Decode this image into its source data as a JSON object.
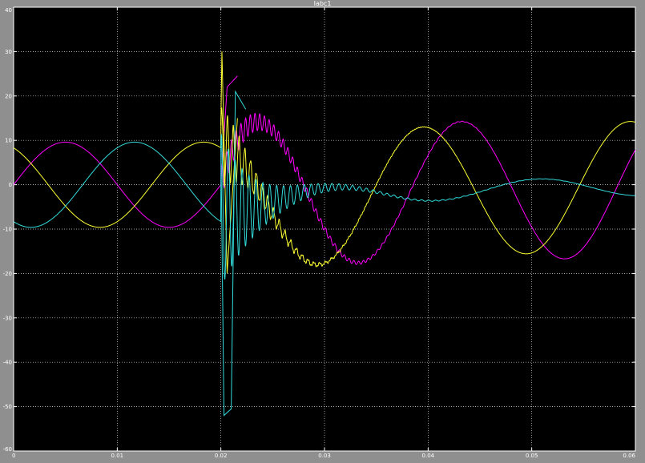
{
  "window": {
    "title": "Iabc1"
  },
  "chart_data": {
    "type": "line",
    "title": "Iabc1",
    "xlabel": "",
    "ylabel": "",
    "xlim": [
      0,
      0.06
    ],
    "ylim": [
      -60,
      40
    ],
    "x_ticks": [
      0,
      0.01,
      0.02,
      0.03,
      0.04,
      0.05,
      0.06
    ],
    "x_tick_labels": [
      "0",
      "0.01",
      "0.02",
      "0.03",
      "0.04",
      "0.05",
      "0.06"
    ],
    "y_ticks": [
      -60,
      -50,
      -40,
      -30,
      -20,
      -10,
      0,
      10,
      20,
      30,
      40
    ],
    "y_tick_labels": [
      "-60",
      "-50",
      "-40",
      "-30",
      "-20",
      "-10",
      "0",
      "10",
      "20",
      "30",
      "40"
    ],
    "grid": true,
    "fault_time": 0.02,
    "series": [
      {
        "color": "#ff00ff",
        "pre_fault": {
          "amplitude": 9.6,
          "phase_deg": 0
        },
        "post_fault": {
          "amplitude": 15.8,
          "dc_offset_peak": 8,
          "peak_time": 0.0432
        },
        "points": [
          [
            0.0,
            0.2
          ],
          [
            0.005,
            9.6
          ],
          [
            0.01,
            0.2
          ],
          [
            0.015,
            -9.6
          ],
          [
            0.0199,
            -0.3
          ],
          [
            0.0206,
            22
          ],
          [
            0.0216,
            24.5
          ],
          [
            0.0226,
            26.5
          ],
          [
            0.024,
            18
          ],
          [
            0.026,
            12
          ],
          [
            0.028,
            2
          ],
          [
            0.03,
            -8
          ],
          [
            0.0332,
            -15.5
          ],
          [
            0.0382,
            0
          ],
          [
            0.0432,
            15.8
          ],
          [
            0.0482,
            0
          ],
          [
            0.0532,
            -15.7
          ],
          [
            0.0582,
            0
          ],
          [
            0.06,
            6
          ]
        ]
      },
      {
        "color": "#ffff33",
        "pre_fault": {
          "amplitude": 9.6,
          "phase_deg": 120
        },
        "post_fault": {
          "amplitude": 14.7,
          "dc_offset_peak": 0,
          "peak_time": 0.0395
        },
        "points": [
          [
            0.0,
            8.3
          ],
          [
            0.0083,
            -9.6
          ],
          [
            0.0183,
            9.6
          ],
          [
            0.0199,
            8.5
          ],
          [
            0.0201,
            30
          ],
          [
            0.0206,
            -20
          ],
          [
            0.0216,
            15
          ],
          [
            0.023,
            10
          ],
          [
            0.025,
            2
          ],
          [
            0.0265,
            -10
          ],
          [
            0.0295,
            -15
          ],
          [
            0.0345,
            0
          ],
          [
            0.0395,
            14.7
          ],
          [
            0.0445,
            0
          ],
          [
            0.0495,
            -14.5
          ],
          [
            0.0545,
            0
          ],
          [
            0.0595,
            14.7
          ]
        ]
      },
      {
        "color": "#33dddd",
        "pre_fault": {
          "amplitude": 9.6,
          "phase_deg": -120
        },
        "post_fault": {
          "amplitude": 2.1,
          "dc_offset_peak": 0,
          "peak_time": 0.0507
        },
        "points": [
          [
            0.0,
            -8.3
          ],
          [
            0.0017,
            -9.6
          ],
          [
            0.0117,
            9.6
          ],
          [
            0.0199,
            -8.5
          ],
          [
            0.0203,
            -52
          ],
          [
            0.021,
            -50.5
          ],
          [
            0.0214,
            21
          ],
          [
            0.0224,
            17
          ],
          [
            0.023,
            -10
          ],
          [
            0.025,
            7
          ],
          [
            0.027,
            4
          ],
          [
            0.029,
            2
          ],
          [
            0.033,
            0
          ],
          [
            0.0407,
            -2
          ],
          [
            0.0507,
            2.1
          ],
          [
            0.06,
            -2
          ]
        ]
      }
    ]
  }
}
